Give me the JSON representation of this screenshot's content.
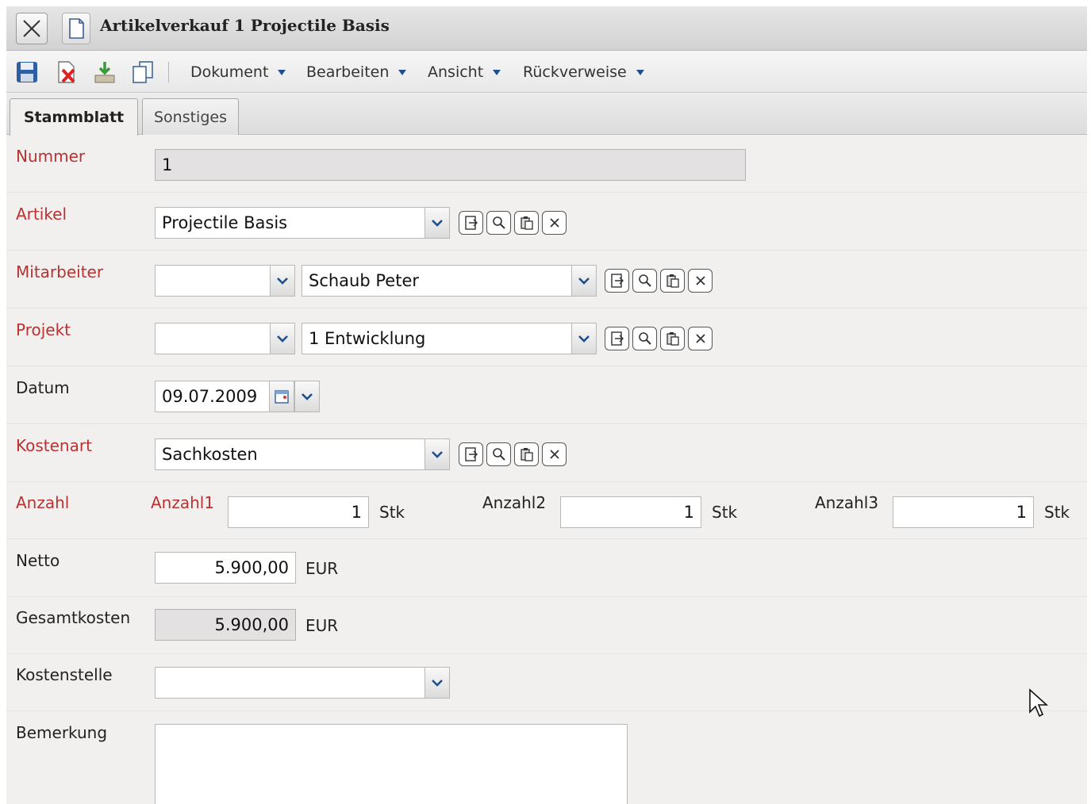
{
  "window": {
    "title": "Artikelverkauf 1 Projectile Basis"
  },
  "toolbar": {
    "icons": [
      "save-icon",
      "delete-icon",
      "download-icon",
      "copy-icon"
    ],
    "menus": [
      {
        "label": "Dokument"
      },
      {
        "label": "Bearbeiten"
      },
      {
        "label": "Ansicht"
      },
      {
        "label": "Rückverweise"
      }
    ]
  },
  "tabs": [
    {
      "label": "Stammblatt",
      "active": true
    },
    {
      "label": "Sonstiges",
      "active": false
    }
  ],
  "form": {
    "nummer": {
      "label": "Nummer",
      "value": "1"
    },
    "artikel": {
      "label": "Artikel",
      "value": "Projectile Basis"
    },
    "mitarbeiter": {
      "label": "Mitarbeiter",
      "code": "",
      "value": "Schaub Peter"
    },
    "projekt": {
      "label": "Projekt",
      "code": "",
      "value": "1 Entwicklung"
    },
    "datum": {
      "label": "Datum",
      "value": "09.07.2009"
    },
    "kostenart": {
      "label": "Kostenart",
      "value": "Sachkosten"
    },
    "anzahl": {
      "label": "Anzahl",
      "fields": [
        {
          "label": "Anzahl1",
          "value": "1",
          "unit": "Stk"
        },
        {
          "label": "Anzahl2",
          "value": "1",
          "unit": "Stk"
        },
        {
          "label": "Anzahl3",
          "value": "1",
          "unit": "Stk"
        }
      ]
    },
    "netto": {
      "label": "Netto",
      "value": "5.900,00",
      "unit": "EUR"
    },
    "gesamtkosten": {
      "label": "Gesamtkosten",
      "value": "5.900,00",
      "unit": "EUR"
    },
    "kostenstelle": {
      "label": "Kostenstelle",
      "value": ""
    },
    "bemerkung": {
      "label": "Bemerkung",
      "value": ""
    }
  },
  "colors": {
    "required_label": "#b83232",
    "accent_blue": "#1f4f8f"
  }
}
